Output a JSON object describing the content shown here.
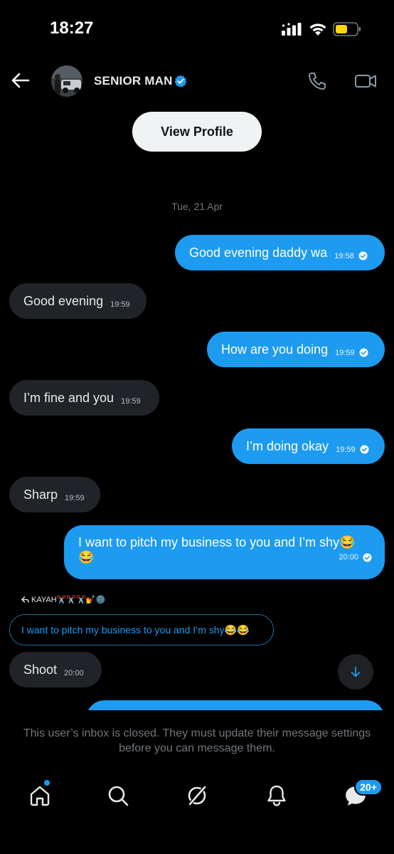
{
  "status_bar": {
    "time": "18:27"
  },
  "header": {
    "contact_name": "SENIOR MAN",
    "view_profile_label": "View Profile"
  },
  "conversation": {
    "date_label": "Tue, 21 Apr",
    "messages": [
      {
        "direction": "outgoing",
        "text": "Good evening daddy wa",
        "time": "19:58"
      },
      {
        "direction": "incoming",
        "text": "Good evening",
        "time": "19:59"
      },
      {
        "direction": "outgoing",
        "text": "How are you doing",
        "time": "19:59"
      },
      {
        "direction": "incoming",
        "text": "I’m fine and you",
        "time": "19:59"
      },
      {
        "direction": "outgoing",
        "text": "I’m doing okay",
        "time": "19:59"
      },
      {
        "direction": "incoming",
        "text": "Sharp",
        "time": "19:59"
      },
      {
        "direction": "outgoing",
        "text": "I want to pitch my business to you and I’m shy😂",
        "text_line2": "😂",
        "time": "20:00"
      },
      {
        "direction": "incoming",
        "text": "Shoot",
        "time": "20:00"
      }
    ],
    "reply": {
      "author": "KAYAH✂️✂️✂️💅🌚",
      "quoted_text": "I want to pitch my business to you and I’m shy😂😂"
    }
  },
  "composer": {
    "inbox_closed_notice": "This user’s inbox is closed. They must update their message settings before you can message them."
  },
  "bottom_nav": {
    "messages_badge": "20+"
  },
  "colors": {
    "background": "#000000",
    "accent": "#1d9bf0",
    "incoming_bubble": "#202327",
    "muted_text": "#71767b"
  }
}
